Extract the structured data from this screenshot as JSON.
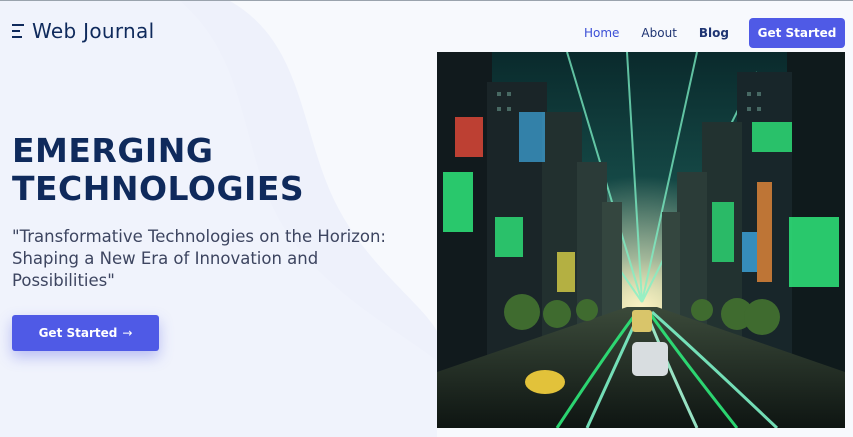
{
  "header": {
    "logo_text": "Web Journal",
    "nav": {
      "home": "Home",
      "about": "About",
      "blog": "Blog",
      "cta": "Get Started"
    }
  },
  "hero": {
    "title_line1": "EMERGING",
    "title_line2": "TECHNOLOGIES",
    "subtitle": "\"Transformative Technologies on the Horizon: Shaping a New Era of Innovation and Possibilities\"",
    "button_label": "Get Started",
    "button_icon": "arrow-right-icon",
    "image_alt": "futuristic city street with neon lights"
  },
  "colors": {
    "primary": "#4f5ae6",
    "heading": "#0f2a5c",
    "nav_active": "#3b4fd6",
    "neon_green": "#2ee87a"
  }
}
